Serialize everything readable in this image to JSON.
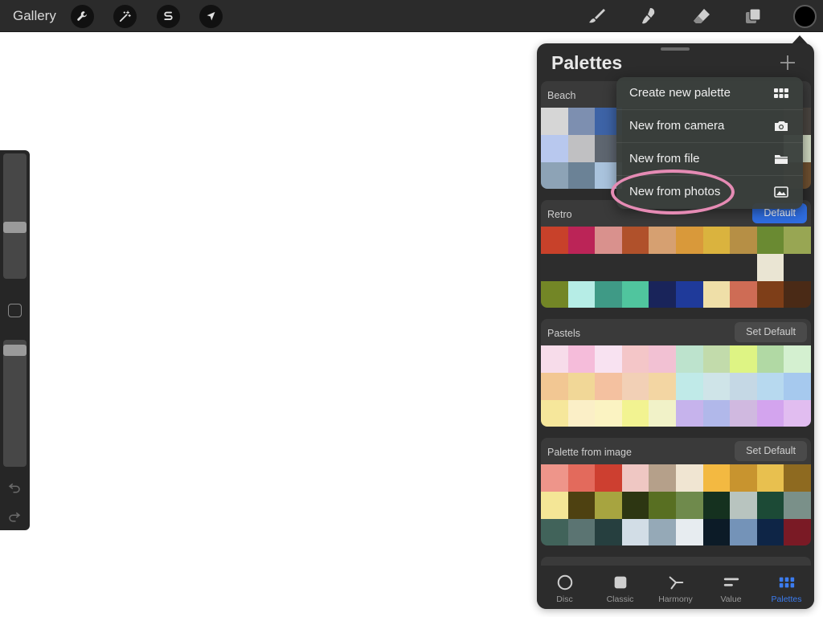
{
  "toolbar": {
    "gallery_label": "Gallery",
    "left_tools": [
      "wrench-icon",
      "magic-wand-icon",
      "selection-s-icon",
      "arrow-transform-icon"
    ],
    "right_tools": [
      "brush-icon",
      "smudge-icon",
      "eraser-icon",
      "layers-icon"
    ],
    "current_color": "#000000"
  },
  "sidebar": {
    "brush_size_level": 0.6,
    "opacity_level": 0.96
  },
  "panel": {
    "title": "Palettes",
    "palettes": [
      {
        "name": "Beach",
        "button": "",
        "colors": [
          "#d6d6d6",
          "#7d8fb0",
          "#3d63a6",
          "#2d2d2d",
          "#2d2d2d",
          "#2d2d2d",
          "#2d2d2d",
          "#2d2d2d",
          "#2d2d2d",
          "#4a4540",
          "#b8c8ee",
          "#c0c0c2",
          "#5e6670",
          "#2d2d2d",
          "#2d2d2d",
          "#2d2d2d",
          "#2d2d2d",
          "#2d2d2d",
          "#2d2d2d",
          "#cfd8c0",
          "#8da3b6",
          "#6b8296",
          "#a9c3dd",
          "#2d2d2d",
          "#2d2d2d",
          "#2d2d2d",
          "#2d2d2d",
          "#2d2d2d",
          "#2d2d2d",
          "#6e5030"
        ]
      },
      {
        "name": "Retro",
        "button": "Default",
        "active": true,
        "colors": [
          "#c8412a",
          "#bb2457",
          "#d9918d",
          "#b0512b",
          "#d6a071",
          "#d9993a",
          "#dab33e",
          "#b68f45",
          "#6a8a32",
          "#98a653",
          "#2d2d2d",
          "#2d2d2d",
          "#2d2d2d",
          "#2d2d2d",
          "#2d2d2d",
          "#2d2d2d",
          "#2d2d2d",
          "#2d2d2d",
          "#eae5d3",
          "#2d2d2d",
          "#738626",
          "#b6ede6",
          "#3f9a86",
          "#50c59e",
          "#19245a",
          "#1f3a9a",
          "#efdfa8",
          "#ce6c55",
          "#7e3e18",
          "#4a2a16"
        ]
      },
      {
        "name": "Pastels",
        "button": "Set Default",
        "colors": [
          "#f7dcea",
          "#f5bcda",
          "#f8e2f1",
          "#f4c6c8",
          "#f2c1d3",
          "#bde3cd",
          "#c2dbab",
          "#def484",
          "#b1d9a4",
          "#d4f0d0",
          "#f2c793",
          "#f1d797",
          "#f4c1a0",
          "#f2d0b6",
          "#f3d6a3",
          "#c0eae8",
          "#cfe4e8",
          "#c5d8e5",
          "#b7d9ef",
          "#a6c9ee",
          "#f6e79b",
          "#fbefc7",
          "#fbf3c2",
          "#f2f391",
          "#f1f2c8",
          "#c6b3ec",
          "#b1b8ea",
          "#d0b9e0",
          "#d3a4ee",
          "#e1bdf0"
        ]
      },
      {
        "name": "Palette from image",
        "button": "Set Default",
        "colors": [
          "#ee958a",
          "#e36a5c",
          "#cd3f30",
          "#efc7c3",
          "#b5a08a",
          "#f0e5d2",
          "#f3b941",
          "#c8942f",
          "#e8c04f",
          "#8e6a20",
          "#f4e696",
          "#4e4111",
          "#a7a440",
          "#2d3612",
          "#586f22",
          "#6f8a4c",
          "#15311f",
          "#b8c4bf",
          "#1c4a36",
          "#7a9089",
          "#41635a",
          "#5b7472",
          "#263f3f",
          "#d2dde6",
          "#95a9b7",
          "#e7ecf0",
          "#0c1b27",
          "#7493b8",
          "#0e2546",
          "#7a1a25"
        ]
      }
    ]
  },
  "menu": {
    "items": [
      {
        "label": "Create new palette",
        "icon": "grid-icon"
      },
      {
        "label": "New from camera",
        "icon": "camera-icon"
      },
      {
        "label": "New from file",
        "icon": "folder-icon"
      },
      {
        "label": "New from photos",
        "icon": "photo-icon"
      }
    ],
    "highlighted_item": "New from photos",
    "highlight_color": "#e58bb4"
  },
  "tabs": [
    {
      "label": "Disc",
      "icon": "disc-icon"
    },
    {
      "label": "Classic",
      "icon": "classic-square-icon"
    },
    {
      "label": "Harmony",
      "icon": "harmony-icon"
    },
    {
      "label": "Value",
      "icon": "value-sliders-icon"
    },
    {
      "label": "Palettes",
      "icon": "palettes-grid-icon",
      "active": true
    }
  ],
  "colors": {
    "accent": "#2f6ee3",
    "active_tab": "#3b7cf0"
  }
}
